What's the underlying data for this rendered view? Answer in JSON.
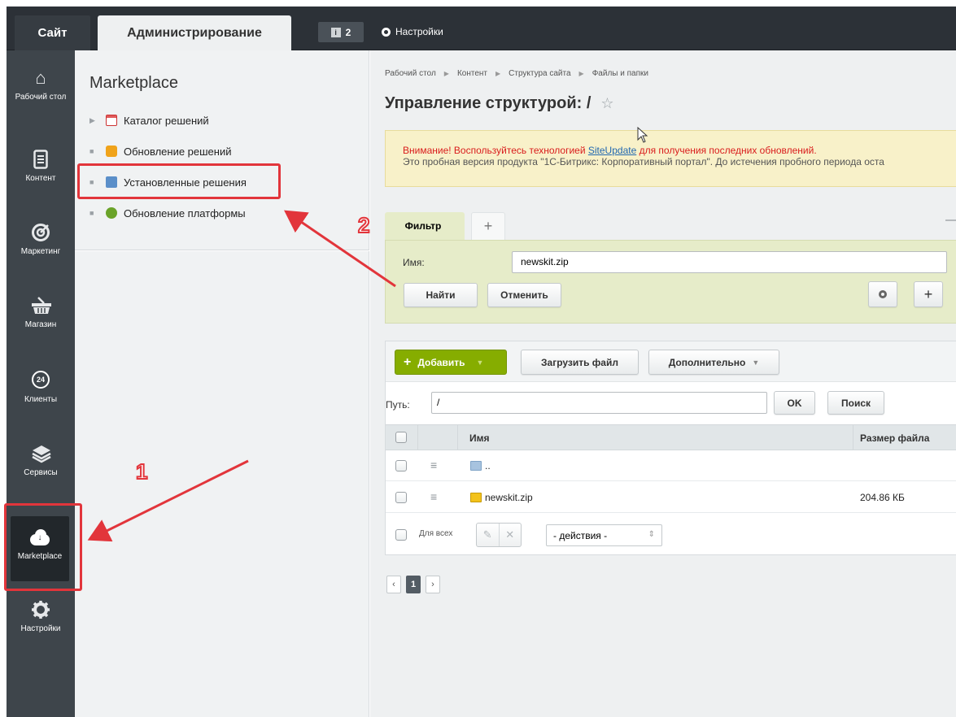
{
  "topbar": {
    "site_tab": "Сайт",
    "admin_tab": "Администрирование",
    "notifications_count": "2",
    "settings_label": "Настройки"
  },
  "leftnav": {
    "items": [
      {
        "label": "Рабочий стол",
        "icon": "home-icon"
      },
      {
        "label": "Контент",
        "icon": "document-icon"
      },
      {
        "label": "Маркетинг",
        "icon": "target-icon"
      },
      {
        "label": "Магазин",
        "icon": "basket-icon"
      },
      {
        "label": "Клиенты",
        "icon": "badge-24-icon",
        "badge_text": "24"
      },
      {
        "label": "Сервисы",
        "icon": "layers-icon"
      },
      {
        "label": "Marketplace",
        "icon": "cloud-download-icon",
        "active": true
      },
      {
        "label": "Настройки",
        "icon": "gear-icon"
      }
    ]
  },
  "submenu": {
    "title": "Marketplace",
    "items": [
      {
        "label": "Каталог решений",
        "marker": "▶"
      },
      {
        "label": "Обновление решений",
        "marker": "■"
      },
      {
        "label": "Установленные решения",
        "marker": "■"
      },
      {
        "label": "Обновление платформы",
        "marker": "■"
      }
    ]
  },
  "main": {
    "breadcrumbs": [
      "Рабочий стол",
      "Контент",
      "Структура сайта",
      "Файлы и папки"
    ],
    "title": "Управление структурой: /",
    "alert": {
      "line1_prefix": "Внимание! Воспользуйтесь технологией ",
      "line1_link": "SiteUpdate",
      "line1_suffix": " для получения последних обновлений.",
      "line2": "Это пробная версия продукта \"1С-Битрикс: Корпоративный портал\". До истечения пробного периода оста"
    },
    "filter": {
      "tab_label": "Фильтр",
      "add_tab": "+",
      "name_label": "Имя:",
      "name_value": "newskit.zip",
      "find_button": "Найти",
      "cancel_button": "Отменить",
      "plus_button": "+"
    },
    "toolbar": {
      "add_button": "Добавить",
      "upload_button": "Загрузить файл",
      "more_button": "Дополнительно"
    },
    "path": {
      "label": "Путь:",
      "value": "/",
      "ok_button": "OK",
      "search_button": "Поиск"
    },
    "table": {
      "columns": {
        "name": "Имя",
        "size": "Размер файла"
      },
      "rows": [
        {
          "name": "..",
          "size": "",
          "icon": "folder-up-icon"
        },
        {
          "name": "newskit.zip",
          "size": "204.86 КБ",
          "icon": "zip-icon"
        }
      ]
    },
    "footer": {
      "for_all_label": "Для всех",
      "actions_select": "- действия -"
    },
    "pager": {
      "prev": "‹",
      "current": "1",
      "next": "›"
    }
  },
  "annotations": {
    "label_1": "1",
    "label_2": "2",
    "color": "#e2353b"
  },
  "colors": {
    "topbar": "#2c3137",
    "leftnav": "#3e454b",
    "add_button": "#86ad00",
    "alert_bg": "#f8f1c9",
    "filter_bg": "#e6ecc9"
  }
}
